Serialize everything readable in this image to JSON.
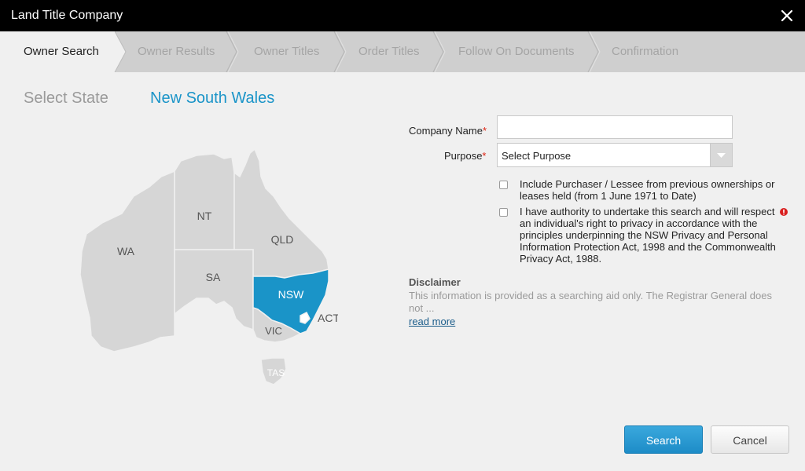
{
  "window": {
    "title": "Land Title Company"
  },
  "steps": [
    {
      "label": "Owner Search",
      "active": true
    },
    {
      "label": "Owner Results",
      "active": false
    },
    {
      "label": "Owner Titles",
      "active": false
    },
    {
      "label": "Order Titles",
      "active": false
    },
    {
      "label": "Follow On Documents",
      "active": false
    },
    {
      "label": "Confirmation",
      "active": false
    }
  ],
  "state_selector": {
    "label": "Select State",
    "selected": "New South Wales"
  },
  "map": {
    "states": [
      "WA",
      "NT",
      "SA",
      "QLD",
      "NSW",
      "ACT",
      "VIC",
      "TAS"
    ],
    "selected": "NSW",
    "selected_color": "#1a94c8",
    "default_color": "#d6d6d6"
  },
  "form": {
    "company_name": {
      "label": "Company Name",
      "value": ""
    },
    "purpose": {
      "label": "Purpose",
      "selected": "Select Purpose"
    },
    "required_mark": "*",
    "include_purchaser": {
      "text": "Include Purchaser / Lessee from previous ownerships or leases held (from 1 June 1971 to Date)",
      "checked": false
    },
    "authority": {
      "text": "I have authority to undertake this search and will respect an individual's right to privacy in accordance with the principles underpinning the NSW Privacy and Personal Information Protection Act, 1998 and the Commonwealth Privacy Act, 1988.",
      "checked": false
    }
  },
  "disclaimer": {
    "title": "Disclaimer",
    "text": "This information is provided as a searching aid only. The Registrar General does not ...",
    "read_more": "read more"
  },
  "buttons": {
    "search": "Search",
    "cancel": "Cancel"
  },
  "icons": {
    "close": "close-icon",
    "dropdown": "chevron-down-icon",
    "warning": "exclamation-icon"
  }
}
